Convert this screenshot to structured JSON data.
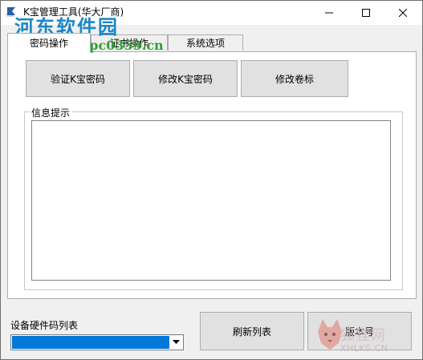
{
  "window": {
    "title": "K宝管理工具(华大厂商)",
    "app_icon": "cidc-logo-icon"
  },
  "watermark": {
    "title": "河东软件园",
    "url": "www.pc0359.cn"
  },
  "tabs": [
    {
      "label": "密码操作",
      "active": true
    },
    {
      "label": "证书操作",
      "active": false
    },
    {
      "label": "系统选项",
      "active": false
    }
  ],
  "panel": {
    "buttons": [
      {
        "label": "验证K宝密码"
      },
      {
        "label": "修改K宝密码"
      },
      {
        "label": "修改卷标"
      }
    ],
    "info_group_label": "信息提示",
    "info_text": ""
  },
  "device": {
    "label": "设备硬件码列表",
    "selected_value": ""
  },
  "bottom_buttons": [
    {
      "label": "刷新列表"
    },
    {
      "label": "版本号"
    }
  ],
  "corner_watermark": {
    "text": "狐狸网",
    "sub": "XHLKS.CN"
  },
  "colors": {
    "selection": "#0078d7",
    "watermark_blue": "#1a86c8",
    "watermark_green": "#2da12d"
  }
}
